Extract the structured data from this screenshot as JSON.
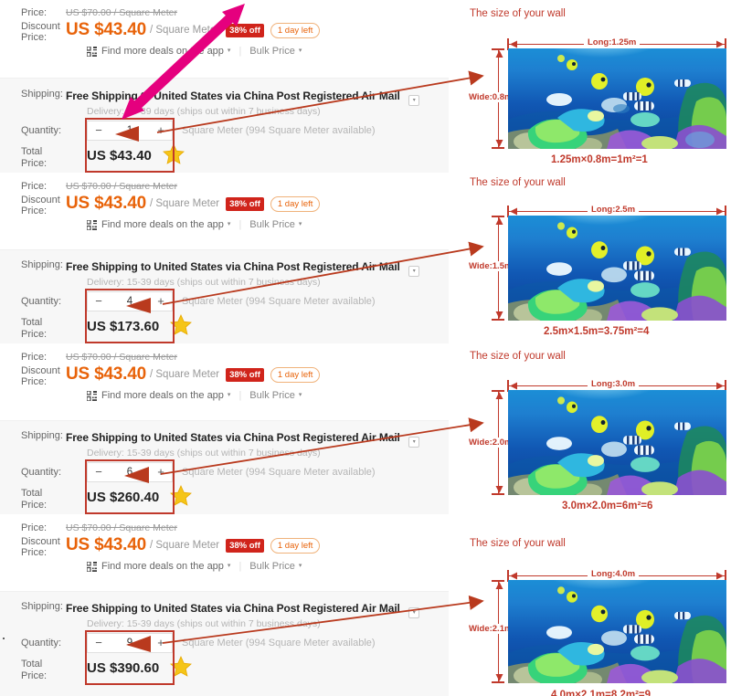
{
  "labels": {
    "price": "Price:",
    "discount_price": "Discount Price:",
    "shipping": "Shipping:",
    "quantity": "Quantity:",
    "total_price": "Total Price:"
  },
  "colors": {
    "discount_orange": "#e8630a",
    "badge_red": "#d0241b",
    "highlight_red": "#c0392b",
    "magenta_arrow": "#e5007e",
    "arrow_red": "#b93a1e",
    "ship_bg": "#f7f7f7"
  },
  "common": {
    "original_price": "US $70.00 / Square Meter",
    "discount_price": "US $43.40",
    "price_unit": "/ Square Meter",
    "discount_badge": "38% off",
    "time_badge": "1 day left",
    "app_deal_text": "Find more deals on the app",
    "bulk_price_text": "Bulk Price",
    "shipping_text": "Free Shipping to United States via China Post Registered Air Mail",
    "delivery_text": "Delivery: 15-39 days (ships out within 7 business days)",
    "quantity_unit": "Square Meter (994 Square Meter available)",
    "minus": "−",
    "plus": "+",
    "caret": "▾",
    "select_caret": "▾",
    "divider": "|"
  },
  "offers": [
    {
      "quantity": "1",
      "total_price": "US $43.40"
    },
    {
      "quantity": "4",
      "total_price": "US $173.60"
    },
    {
      "quantity": "6",
      "total_price": "US $260.40"
    },
    {
      "quantity": "9",
      "total_price": "US $390.60"
    }
  ],
  "walls": [
    {
      "title": "The size of your wall",
      "long_label": "Long:1.25m",
      "wide_label": "Wide:0.8m",
      "equation": "1.25m×0.8m=1m²=1"
    },
    {
      "title": "The size of your wall",
      "long_label": "Long:2.5m",
      "wide_label": "Wide:1.5m",
      "equation": "2.5m×1.5m=3.75m²=4"
    },
    {
      "title": "The size of your wall",
      "long_label": "Long:3.0m",
      "wide_label": "Wide:2.0m",
      "equation": "3.0m×2.0m=6m²=6"
    },
    {
      "title": "The size of your wall",
      "long_label": "Long:4.0m",
      "wide_label": "Wide:2.1m",
      "equation": "4.0m×2.1m=8.2m²=9"
    }
  ]
}
